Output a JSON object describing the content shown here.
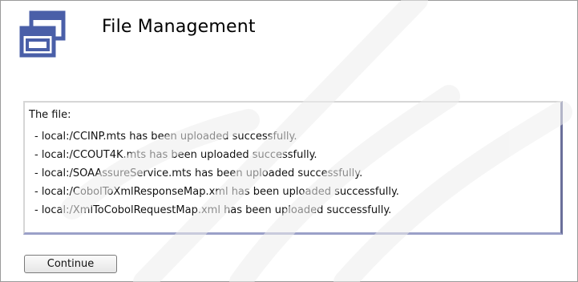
{
  "header": {
    "title": "File Management",
    "icon": "window-stack-icon"
  },
  "message": {
    "heading": "The file:",
    "items": [
      "- local:/CCINP.mts has been uploaded successfully.",
      "- local:/CCOUT4K.mts has been uploaded successfully.",
      "- local:/SOAAssureService.mts has been uploaded successfully.",
      "- local:/CobolToXmlResponseMap.xml has been uploaded successfully.",
      "- local:/XmlToCobolRequestMap.xml has been uploaded successfully."
    ]
  },
  "actions": {
    "continue_label": "Continue"
  },
  "colors": {
    "icon_blue": "#4a5fa8",
    "box_shadow": "#6a6f9a"
  }
}
